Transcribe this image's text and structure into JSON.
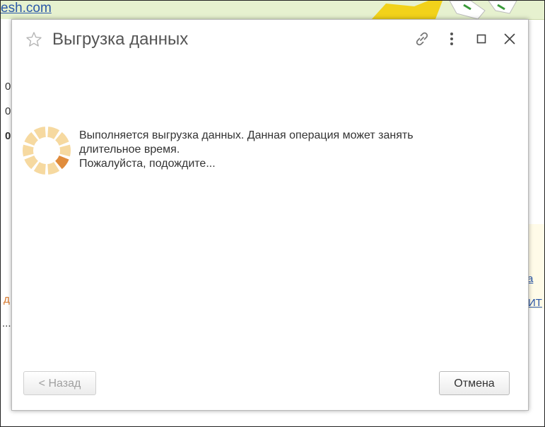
{
  "background": {
    "link_fragment": "esh.com",
    "left_fragments": [
      "0",
      "0",
      "0"
    ],
    "left_bottom_fragment": "д",
    "left_ellipsis": "...",
    "right_fragments": [
      "а",
      "ИТ"
    ]
  },
  "dialog": {
    "title": "Выгрузка данных",
    "message_line1": "Выполняется выгрузка данных. Данная операция может занять",
    "message_line2": "длительное время.",
    "message_line3": "Пожалуйста, подождите...",
    "back_label": "< Назад",
    "cancel_label": "Отмена",
    "icons": {
      "favorite": "star-icon",
      "link": "link-icon",
      "more": "more-vertical-icon",
      "maximize": "maximize-icon",
      "close": "close-icon",
      "spinner": "loading-spinner"
    }
  },
  "colors": {
    "spinner_light": "#f6d9a0",
    "spinner_active": "#e08c3c",
    "link": "#2a57a8",
    "header_bg": "#e6f1cf"
  }
}
